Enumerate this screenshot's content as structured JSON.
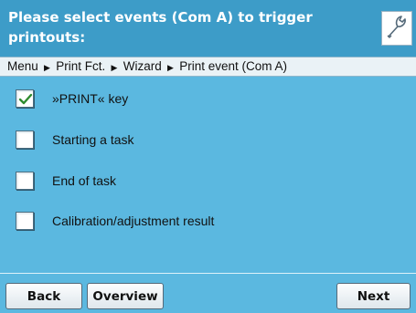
{
  "header": {
    "title": "Please select events (Com A) to trigger printouts:",
    "settings_icon": "wrench-icon"
  },
  "breadcrumb": {
    "items": [
      "Menu",
      "Print Fct.",
      "Wizard",
      "Print event (Com A)"
    ],
    "separator_icon": "triangle-right-icon"
  },
  "events": [
    {
      "label": "»PRINT« key",
      "checked": true
    },
    {
      "label": "Starting a task",
      "checked": false
    },
    {
      "label": "End of task",
      "checked": false
    },
    {
      "label": "Calibration/adjustment result",
      "checked": false
    }
  ],
  "footer": {
    "back_label": "Back",
    "overview_label": "Overview",
    "next_label": "Next"
  },
  "colors": {
    "background": "#5bb8e0",
    "title_bar": "#3d9cc8",
    "checkmark": "#2e8b2e"
  }
}
